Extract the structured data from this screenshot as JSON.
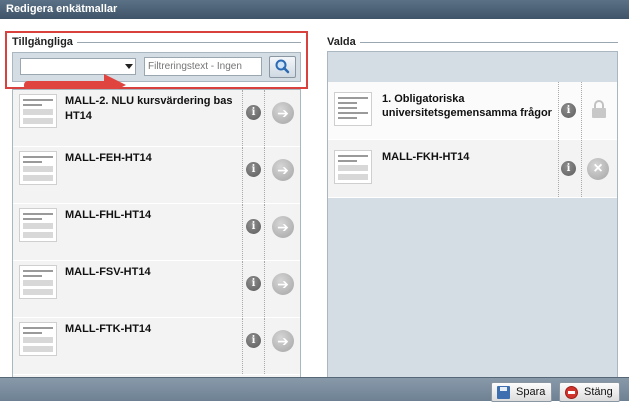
{
  "window": {
    "title": "Redigera enkätmallar"
  },
  "available": {
    "legend": "Tillgängliga",
    "filter": {
      "selected": "",
      "placeholder": "Filtreringstext - Ingen"
    },
    "items": [
      {
        "name": "MALL-2. NLU kursvärdering bas HT14"
      },
      {
        "name": "MALL-FEH-HT14"
      },
      {
        "name": "MALL-FHL-HT14"
      },
      {
        "name": "MALL-FSV-HT14"
      },
      {
        "name": "MALL-FTK-HT14"
      }
    ]
  },
  "selected": {
    "legend": "Valda",
    "items": [
      {
        "name": "1. Obligatoriska universitetsgemensamma frågor",
        "locked": true
      },
      {
        "name": "MALL-FKH-HT14",
        "locked": false
      }
    ]
  },
  "footer": {
    "save_label": "Spara",
    "close_label": "Stäng"
  },
  "colors": {
    "annotation": "#e0443f",
    "titlebar": "#4b6075"
  }
}
